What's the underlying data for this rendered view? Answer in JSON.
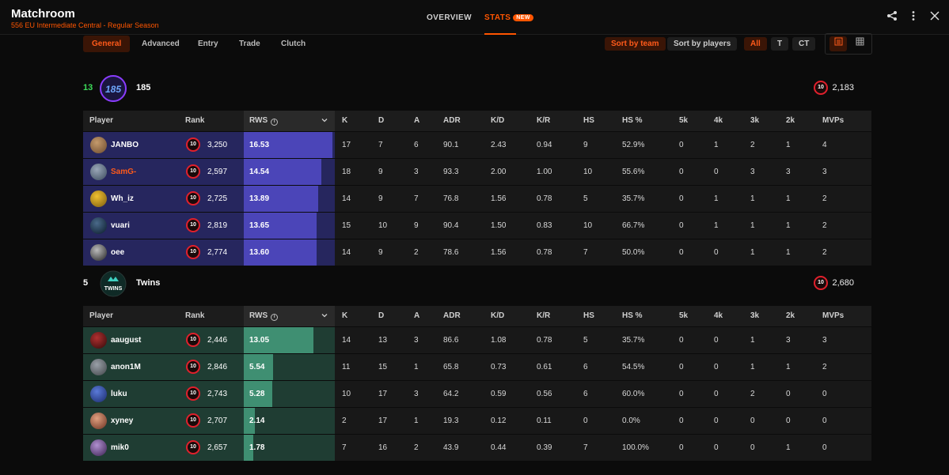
{
  "header": {
    "title": "Matchroom",
    "subtitle": "556 EU Intermediate Central - Regular Season",
    "tabs": [
      {
        "label": "OVERVIEW"
      },
      {
        "label": "STATS",
        "badge": "NEW"
      }
    ]
  },
  "subtabs": [
    "General",
    "Advanced",
    "Entry",
    "Trade",
    "Clutch"
  ],
  "sort": {
    "team": "Sort by team",
    "players": "Sort by players"
  },
  "sides": [
    "All",
    "T",
    "CT"
  ],
  "columns": [
    "Player",
    "Rank",
    "RWS",
    "K",
    "D",
    "A",
    "ADR",
    "K/D",
    "K/R",
    "HS",
    "HS %",
    "5k",
    "4k",
    "3k",
    "2k",
    "MVPs"
  ],
  "level": "10",
  "teams": [
    {
      "score": "13",
      "score_color": "#3ddc5a",
      "name": "185",
      "elo": "2,183",
      "accent": "#4b45b8",
      "row_bg": "#26265e",
      "players": [
        {
          "name": "JANBO",
          "rank": "3,250",
          "rws": "16.53",
          "rws_num": 16.53,
          "k": "17",
          "d": "7",
          "a": "6",
          "adr": "90.1",
          "kd": "2.43",
          "kr": "0.94",
          "hs": "9",
          "hsp": "52.9%",
          "k5": "0",
          "k4": "1",
          "k3": "2",
          "k2": "1",
          "mvps": "4"
        },
        {
          "name": "SamG-",
          "rank": "2,597",
          "rws": "14.54",
          "rws_num": 14.54,
          "k": "18",
          "d": "9",
          "a": "3",
          "adr": "93.3",
          "kd": "2.00",
          "kr": "1.00",
          "hs": "10",
          "hsp": "55.6%",
          "k5": "0",
          "k4": "0",
          "k3": "3",
          "k2": "3",
          "mvps": "3",
          "highlight": true
        },
        {
          "name": "Wh_iz",
          "rank": "2,725",
          "rws": "13.89",
          "rws_num": 13.89,
          "k": "14",
          "d": "9",
          "a": "7",
          "adr": "76.8",
          "kd": "1.56",
          "kr": "0.78",
          "hs": "5",
          "hsp": "35.7%",
          "k5": "0",
          "k4": "1",
          "k3": "1",
          "k2": "1",
          "mvps": "2"
        },
        {
          "name": "vuari",
          "rank": "2,819",
          "rws": "13.65",
          "rws_num": 13.65,
          "k": "15",
          "d": "10",
          "a": "9",
          "adr": "90.4",
          "kd": "1.50",
          "kr": "0.83",
          "hs": "10",
          "hsp": "66.7%",
          "k5": "0",
          "k4": "1",
          "k3": "1",
          "k2": "1",
          "mvps": "2"
        },
        {
          "name": "oee",
          "rank": "2,774",
          "rws": "13.60",
          "rws_num": 13.6,
          "k": "14",
          "d": "9",
          "a": "2",
          "adr": "78.6",
          "kd": "1.56",
          "kr": "0.78",
          "hs": "7",
          "hsp": "50.0%",
          "k5": "0",
          "k4": "0",
          "k3": "1",
          "k2": "1",
          "mvps": "2"
        }
      ]
    },
    {
      "score": "5",
      "score_color": "#ffffff",
      "name": "Twins",
      "elo": "2,680",
      "accent": "#3f8f72",
      "row_bg": "#1f3d33",
      "players": [
        {
          "name": "aaugust",
          "rank": "2,446",
          "rws": "13.05",
          "rws_num": 13.05,
          "k": "14",
          "d": "13",
          "a": "3",
          "adr": "86.6",
          "kd": "1.08",
          "kr": "0.78",
          "hs": "5",
          "hsp": "35.7%",
          "k5": "0",
          "k4": "0",
          "k3": "1",
          "k2": "3",
          "mvps": "3"
        },
        {
          "name": "anon1M",
          "rank": "2,846",
          "rws": "5.54",
          "rws_num": 5.54,
          "k": "11",
          "d": "15",
          "a": "1",
          "adr": "65.8",
          "kd": "0.73",
          "kr": "0.61",
          "hs": "6",
          "hsp": "54.5%",
          "k5": "0",
          "k4": "0",
          "k3": "1",
          "k2": "1",
          "mvps": "2"
        },
        {
          "name": "luku",
          "rank": "2,743",
          "rws": "5.28",
          "rws_num": 5.28,
          "k": "10",
          "d": "17",
          "a": "3",
          "adr": "64.2",
          "kd": "0.59",
          "kr": "0.56",
          "hs": "6",
          "hsp": "60.0%",
          "k5": "0",
          "k4": "0",
          "k3": "2",
          "k2": "0",
          "mvps": "0"
        },
        {
          "name": "xyney",
          "rank": "2,707",
          "rws": "2.14",
          "rws_num": 2.14,
          "k": "2",
          "d": "17",
          "a": "1",
          "adr": "19.3",
          "kd": "0.12",
          "kr": "0.11",
          "hs": "0",
          "hsp": "0.0%",
          "k5": "0",
          "k4": "0",
          "k3": "0",
          "k2": "0",
          "mvps": "0"
        },
        {
          "name": "mik0",
          "rank": "2,657",
          "rws": "1.78",
          "rws_num": 1.78,
          "k": "7",
          "d": "16",
          "a": "2",
          "adr": "43.9",
          "kd": "0.44",
          "kr": "0.39",
          "hs": "7",
          "hsp": "100.0%",
          "k5": "0",
          "k4": "0",
          "k3": "0",
          "k2": "1",
          "mvps": "0"
        }
      ]
    }
  ],
  "icons": {
    "share": "share-icon",
    "more": "more-vertical-icon",
    "close": "close-icon"
  }
}
